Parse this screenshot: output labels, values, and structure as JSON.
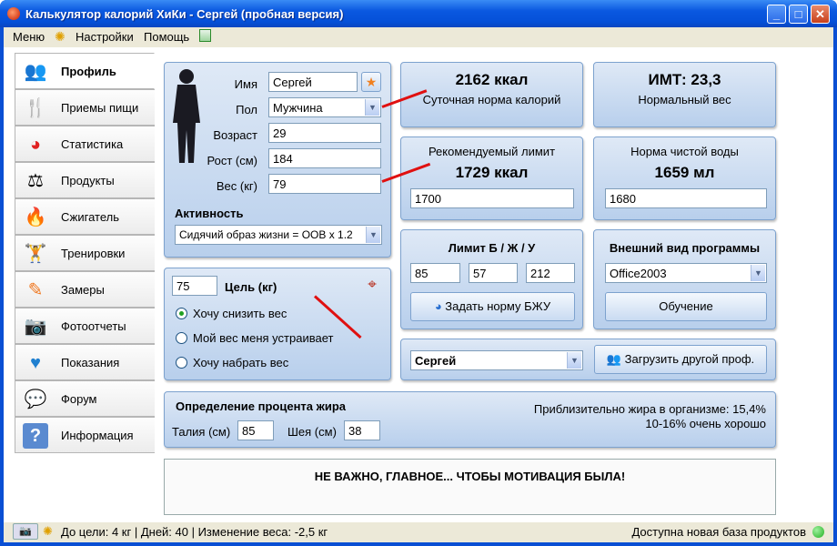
{
  "window": {
    "title": "Калькулятор калорий ХиКи - Сергей (пробная версия)"
  },
  "menu": {
    "items": [
      "Меню",
      "Настройки",
      "Помощь"
    ]
  },
  "tabs": [
    {
      "label": "Профиль",
      "icon": "profile-icon",
      "glyph": "👥"
    },
    {
      "label": "Приемы пищи",
      "icon": "fork-knife-icon",
      "glyph": "🍴"
    },
    {
      "label": "Статистика",
      "icon": "pie-chart-icon",
      "glyph": "◕"
    },
    {
      "label": "Продукты",
      "icon": "scale-icon",
      "glyph": "⚖"
    },
    {
      "label": "Сжигатель",
      "icon": "fire-icon",
      "glyph": "🔥"
    },
    {
      "label": "Тренировки",
      "icon": "dumbbell-icon",
      "glyph": "🏋"
    },
    {
      "label": "Замеры",
      "icon": "pencil-icon",
      "glyph": "✎"
    },
    {
      "label": "Фотоотчеты",
      "icon": "camera-icon",
      "glyph": "📷"
    },
    {
      "label": "Показания",
      "icon": "heart-pulse-icon",
      "glyph": "♥"
    },
    {
      "label": "Форум",
      "icon": "chat-icon",
      "glyph": "💬"
    },
    {
      "label": "Информация",
      "icon": "info-icon",
      "glyph": "?"
    }
  ],
  "profile": {
    "name_label": "Имя",
    "name": "Сергей",
    "sex_label": "Пол",
    "sex": "Мужчина",
    "age_label": "Возраст",
    "age": "29",
    "height_label": "Рост (см)",
    "height": "184",
    "weight_label": "Вес (кг)",
    "weight": "79",
    "activity_label": "Активность",
    "activity": "Сидячий образ жизни = ООВ x 1.2"
  },
  "goal": {
    "value": "75",
    "label": "Цель (кг)",
    "options": [
      "Хочу снизить вес",
      "Мой вес меня устраивает",
      "Хочу набрать вес"
    ],
    "selected": 0
  },
  "calories": {
    "value": "2162 ккал",
    "label": "Суточная норма калорий"
  },
  "bmi": {
    "value": "ИМТ: 23,3",
    "label": "Нормальный вес"
  },
  "limit": {
    "label": "Рекомендуемый лимит",
    "value": "1729 ккал",
    "input": "1700"
  },
  "water": {
    "label": "Норма чистой воды",
    "value": "1659 мл",
    "input": "1680"
  },
  "bju": {
    "label": "Лимит Б / Ж / У",
    "protein": "85",
    "fat": "57",
    "carbs": "212",
    "button": "Задать норму БЖУ"
  },
  "appearance": {
    "label": "Внешний вид программы",
    "value": "Office2003",
    "button": "Обучение"
  },
  "profile_switch": {
    "value": "Сергей",
    "button": "Загрузить другой проф."
  },
  "fat": {
    "title": "Определение процента жира",
    "waist_label": "Талия (см)",
    "waist": "85",
    "neck_label": "Шея (см)",
    "neck": "38",
    "result": "Приблизительно жира в организме: 15,4%",
    "rating": "10-16% очень хорошо"
  },
  "motivation": "НЕ ВАЖНО, ГЛАВНОЕ... ЧТОБЫ МОТИВАЦИЯ БЫЛА!",
  "status": {
    "left": "До цели: 4 кг | Дней: 40 | Изменение веса: -2,5 кг",
    "right": "Доступна новая база продуктов"
  },
  "colors": {
    "accent": "#0a58e0",
    "arrow": "#e01010",
    "status_ok": "#22b022"
  }
}
